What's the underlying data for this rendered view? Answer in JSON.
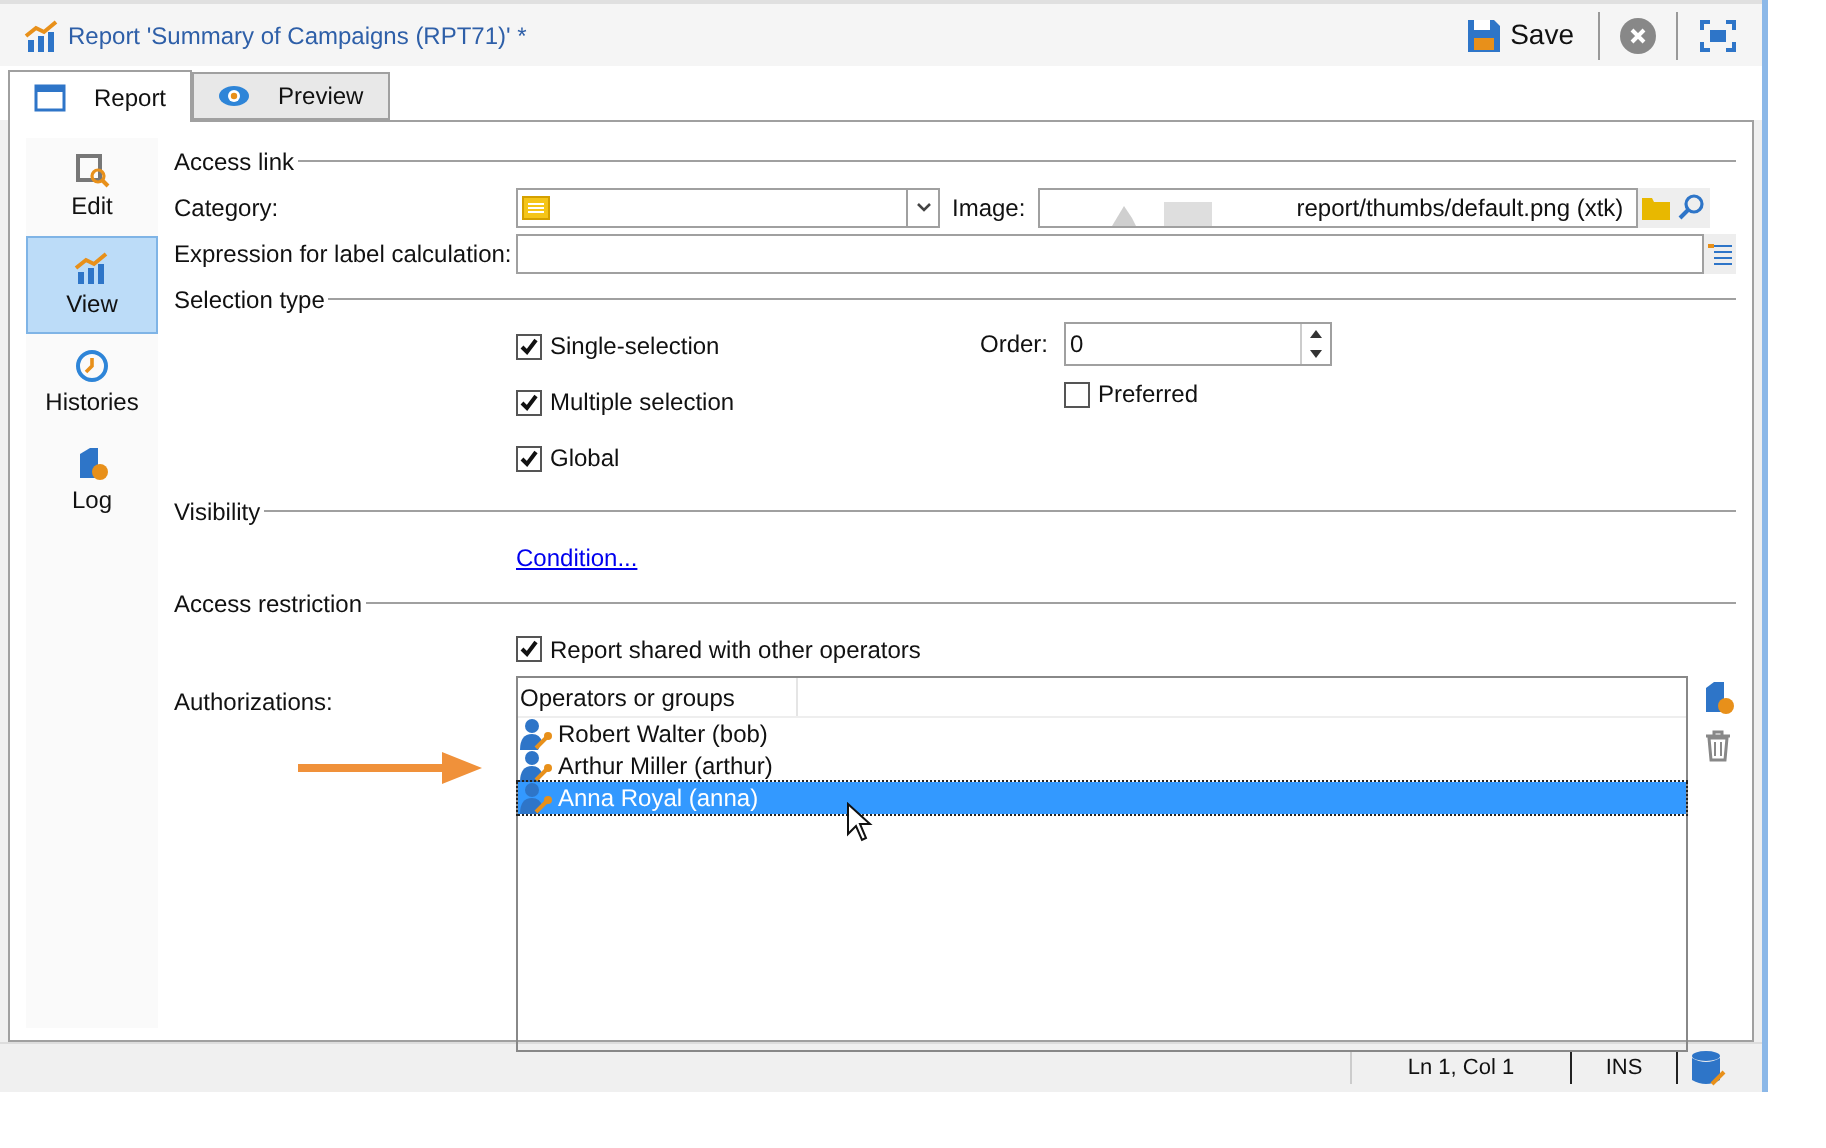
{
  "window": {
    "title": "Report 'Summary of Campaigns (RPT71)' *"
  },
  "toolbar": {
    "save": "Save"
  },
  "tabs": [
    {
      "label": "Report",
      "kind": "window",
      "selected": true
    },
    {
      "label": "Preview",
      "kind": "eye",
      "selected": false
    }
  ],
  "sidebar": {
    "items": [
      {
        "label": "Edit",
        "kind": "edit",
        "selected": false
      },
      {
        "label": "View",
        "kind": "chart",
        "selected": true
      },
      {
        "label": "Histories",
        "kind": "clock",
        "selected": false
      },
      {
        "label": "Log",
        "kind": "log",
        "selected": false
      }
    ]
  },
  "access_link": {
    "title": "Access link",
    "category_label": "Category:",
    "image_label": "Image:",
    "image_value": "report/thumbs/default.png (xtk)",
    "expression_label": "Expression for label calculation:"
  },
  "selection_type": {
    "title": "Selection type",
    "order_label": "Order:",
    "order_value": "0",
    "options": [
      {
        "label": "Single-selection",
        "checked": true
      },
      {
        "label": "Multiple selection",
        "checked": true
      },
      {
        "label": "Global",
        "checked": true
      }
    ],
    "preferred": {
      "label": "Preferred",
      "checked": false
    }
  },
  "visibility": {
    "title": "Visibility",
    "link": "Condition..."
  },
  "access_restriction": {
    "title": "Access restriction",
    "shared": {
      "label": "Report shared with other operators",
      "checked": true
    },
    "authorizations_label": "Authorizations:",
    "list": {
      "column": "Operators or groups",
      "rows": [
        {
          "name": "Robert Walter (bob)",
          "selected": false
        },
        {
          "name": "Arthur Miller (arthur)",
          "selected": false
        },
        {
          "name": "Anna Royal (anna)",
          "selected": true
        }
      ]
    }
  },
  "status_bar": {
    "position": "Ln 1, Col 1",
    "mode": "INS"
  }
}
